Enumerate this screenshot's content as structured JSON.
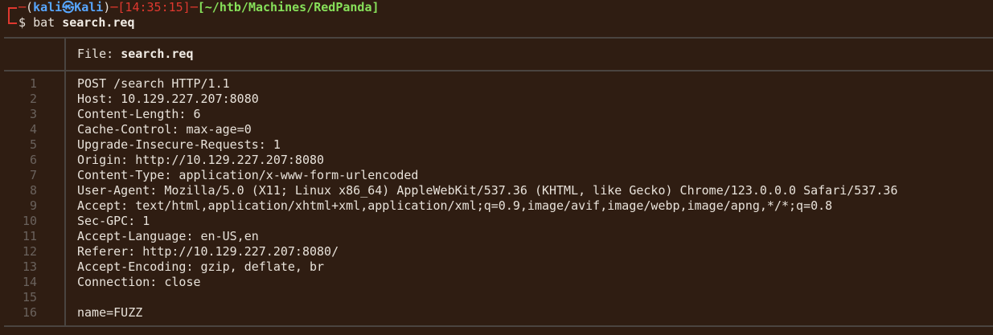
{
  "prompt": {
    "user": "kali",
    "separator_icon": "skull-icon",
    "host": "Kali",
    "time": "[14:35:15]",
    "path": "[~/htb/Machines/RedPanda]",
    "dollar": "$",
    "command": "bat",
    "argument": "search.req"
  },
  "file_header": {
    "label": "File:",
    "name": "search.req"
  },
  "lines": [
    {
      "n": "1",
      "text": "POST /search HTTP/1.1"
    },
    {
      "n": "2",
      "text": "Host: 10.129.227.207:8080"
    },
    {
      "n": "3",
      "text": "Content-Length: 6"
    },
    {
      "n": "4",
      "text": "Cache-Control: max-age=0"
    },
    {
      "n": "5",
      "text": "Upgrade-Insecure-Requests: 1"
    },
    {
      "n": "6",
      "text": "Origin: http://10.129.227.207:8080"
    },
    {
      "n": "7",
      "text": "Content-Type: application/x-www-form-urlencoded"
    },
    {
      "n": "8",
      "text": "User-Agent: Mozilla/5.0 (X11; Linux x86_64) AppleWebKit/537.36 (KHTML, like Gecko) Chrome/123.0.0.0 Safari/537.36"
    },
    {
      "n": "9",
      "text": "Accept: text/html,application/xhtml+xml,application/xml;q=0.9,image/avif,image/webp,image/apng,*/*;q=0.8"
    },
    {
      "n": "10",
      "text": "Sec-GPC: 1"
    },
    {
      "n": "11",
      "text": "Accept-Language: en-US,en"
    },
    {
      "n": "12",
      "text": "Referer: http://10.129.227.207:8080/"
    },
    {
      "n": "13",
      "text": "Accept-Encoding: gzip, deflate, br"
    },
    {
      "n": "14",
      "text": "Connection: close"
    },
    {
      "n": "15",
      "text": ""
    },
    {
      "n": "16",
      "text": "name=FUZZ"
    }
  ],
  "colors": {
    "background": "#2f1d12",
    "prompt_red": "#e0382f",
    "host_blue": "#57a6ff",
    "path_green": "#87e15a",
    "line_number_gray": "#6a625d",
    "rule_gray": "#4a4440"
  }
}
